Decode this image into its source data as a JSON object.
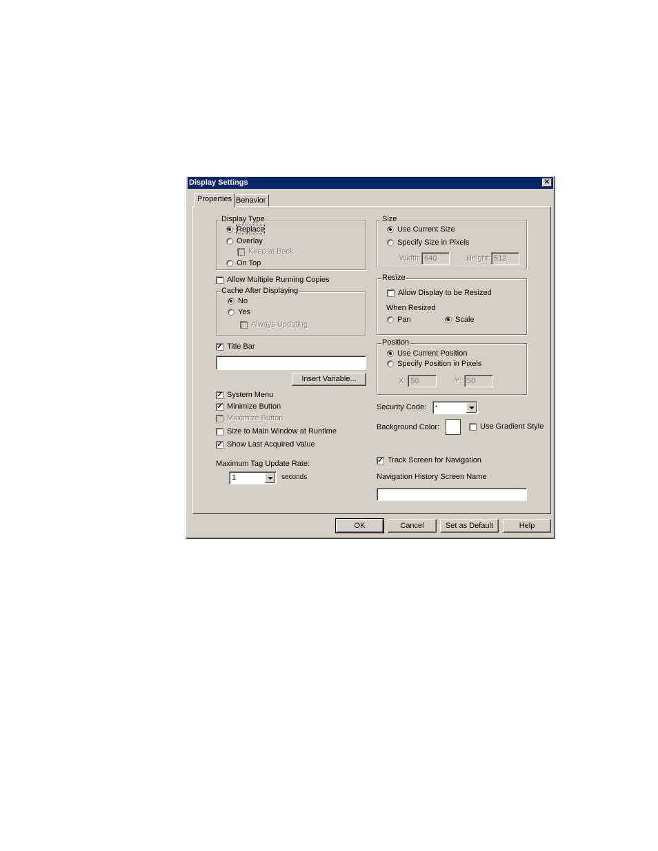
{
  "window": {
    "title": "Display Settings",
    "close_icon": "close-icon"
  },
  "tabs": [
    {
      "label": "Properties",
      "active": true
    },
    {
      "label": "Behavior",
      "active": false
    }
  ],
  "display_type": {
    "label": "Display Type",
    "options": [
      {
        "label": "Replace",
        "selected": true
      },
      {
        "label": "Overlay",
        "selected": false
      },
      {
        "label": "On Top",
        "selected": false
      }
    ],
    "keep_at_back": {
      "label": "Keep at Back",
      "checked": false,
      "enabled": false
    }
  },
  "allow_multiple": {
    "label": "Allow Multiple Running Copies",
    "checked": false
  },
  "cache": {
    "label": "Cache After Displaying",
    "options": [
      {
        "label": "No",
        "selected": true
      },
      {
        "label": "Yes",
        "selected": false
      }
    ],
    "always_updating": {
      "label": "Always Updating",
      "checked": false,
      "enabled": false
    }
  },
  "title_bar": {
    "label": "Title Bar",
    "checked": true,
    "value": "",
    "insert_variable_label": "Insert Variable..."
  },
  "options": [
    {
      "label": "System Menu",
      "checked": true,
      "enabled": true
    },
    {
      "label": "Minimize Button",
      "checked": true,
      "enabled": true
    },
    {
      "label": "Maximize Button",
      "checked": false,
      "enabled": false
    },
    {
      "label": "Size to Main Window at Runtime",
      "checked": false,
      "enabled": true
    },
    {
      "label": "Show Last Acquired Value",
      "checked": true,
      "enabled": true
    }
  ],
  "update_rate": {
    "label": "Maximum Tag Update Rate:",
    "value": "1",
    "unit": "seconds"
  },
  "size": {
    "label": "Size",
    "options": [
      {
        "label": "Use Current Size",
        "selected": true
      },
      {
        "label": "Specify Size in Pixels",
        "selected": false
      }
    ],
    "width_label": "Width:",
    "width_value": "640",
    "height_label": "Height:",
    "height_value": "512"
  },
  "resize": {
    "label": "Resize",
    "allow_label": "Allow Display to be Resized",
    "allow_checked": false,
    "when_resized_label": "When Resized",
    "options": [
      {
        "label": "Pan",
        "selected": false
      },
      {
        "label": "Scale",
        "selected": true
      }
    ]
  },
  "position": {
    "label": "Position",
    "options": [
      {
        "label": "Use Current Position",
        "selected": true
      },
      {
        "label": "Specify Position in Pixels",
        "selected": false
      }
    ],
    "x_label": "X:",
    "x_value": "50",
    "y_label": "Y:",
    "y_value": "50"
  },
  "security": {
    "label": "Security Code:",
    "value": "*"
  },
  "background": {
    "label": "Background Color:",
    "color": "#ffffff",
    "gradient_label": "Use Gradient Style",
    "gradient_checked": false
  },
  "navigation": {
    "track_label": "Track Screen for Navigation",
    "track_checked": true,
    "history_label": "Navigation History Screen Name",
    "history_value": ""
  },
  "buttons": {
    "ok": "OK",
    "cancel": "Cancel",
    "set_default": "Set as Default",
    "help": "Help"
  },
  "colors": {
    "titlebar": "#0a246a",
    "face": "#d4d0c8"
  }
}
